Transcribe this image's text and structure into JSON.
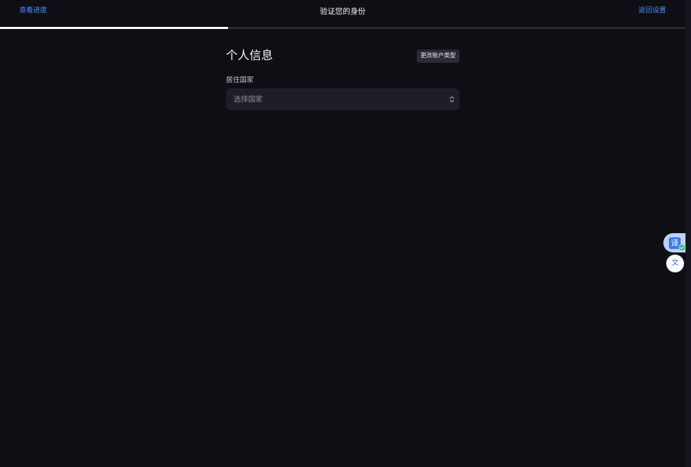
{
  "theme": {
    "background": "#0e0f15",
    "accent": "#4a8cf7",
    "text_primary": "#f2f3f5",
    "progress_fill": "#ffffff",
    "progress_track": "#2a2b31"
  },
  "header": {
    "view_progress": "查看进度",
    "title": "验证您的身份",
    "back_to_settings": "返回设置"
  },
  "progress": {
    "fraction": 0.333
  },
  "section": {
    "title": "个人信息",
    "change_account_type": "更改账户类型"
  },
  "form": {
    "country": {
      "label": "居住国家",
      "placeholder": "选择国家",
      "icon": "chevron-up-down-icon"
    }
  },
  "translator": {
    "translate_icon_text": "译",
    "translate_icon": "translate-icon",
    "status_icon": "check-badge-icon",
    "text_button_text": "文"
  }
}
